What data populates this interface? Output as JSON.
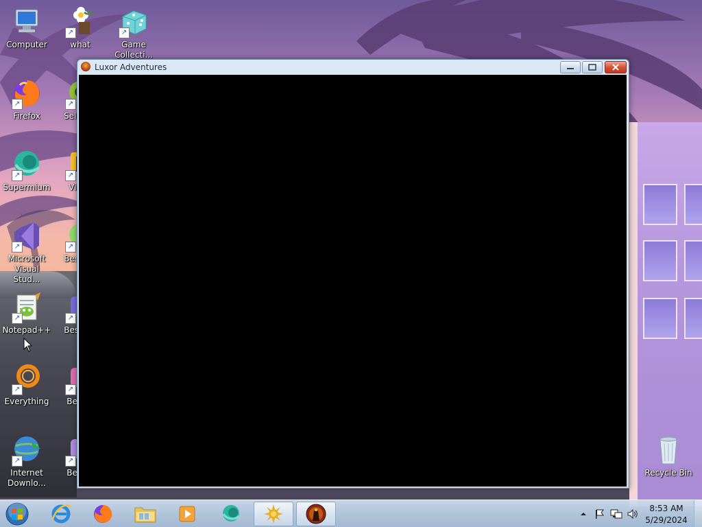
{
  "desktop": {
    "icons": [
      {
        "label": "Computer",
        "icon": "computer-icon"
      },
      {
        "label": "what",
        "icon": "flower-icon"
      },
      {
        "label": "Game Collecti...",
        "icon": "dice-icon"
      },
      {
        "label": "Firefox",
        "icon": "firefox-icon"
      },
      {
        "label": "Sele We",
        "icon": "app-icon"
      },
      {
        "label": "Supermium",
        "icon": "supermium-icon"
      },
      {
        "label": "Vis St",
        "icon": "app-icon"
      },
      {
        "label": "Microsoft Visual Stud...",
        "icon": "visual-studio-icon"
      },
      {
        "label": "Best Hit",
        "icon": "game-icon"
      },
      {
        "label": "Notepad++",
        "icon": "notepadpp-icon"
      },
      {
        "label": "Best Hit",
        "icon": "game-icon"
      },
      {
        "label": "Everything",
        "icon": "everything-icon"
      },
      {
        "label": "Best H",
        "icon": "game-icon"
      },
      {
        "label": "Internet Downlo...",
        "icon": "idm-icon"
      },
      {
        "label": "Best H",
        "icon": "game-icon"
      },
      {
        "label": "Recycle Bin",
        "icon": "recycle-bin-icon"
      }
    ]
  },
  "window": {
    "title": "Luxor Adventures",
    "buttons": {
      "minimize": "minimize",
      "maximize": "maximize",
      "close": "close"
    }
  },
  "taskbar": {
    "items": [
      {
        "name": "internet-explorer",
        "icon": "ie-icon"
      },
      {
        "name": "firefox",
        "icon": "firefox-icon"
      },
      {
        "name": "file-explorer",
        "icon": "folder-icon"
      },
      {
        "name": "media-player",
        "icon": "media-player-icon"
      },
      {
        "name": "supermium",
        "icon": "supermium-icon"
      },
      {
        "name": "sun-game",
        "icon": "sun-icon"
      },
      {
        "name": "luxor-adventures",
        "icon": "luxor-icon"
      }
    ],
    "clock": {
      "time": "8:53 AM",
      "date": "5/29/2024"
    }
  }
}
